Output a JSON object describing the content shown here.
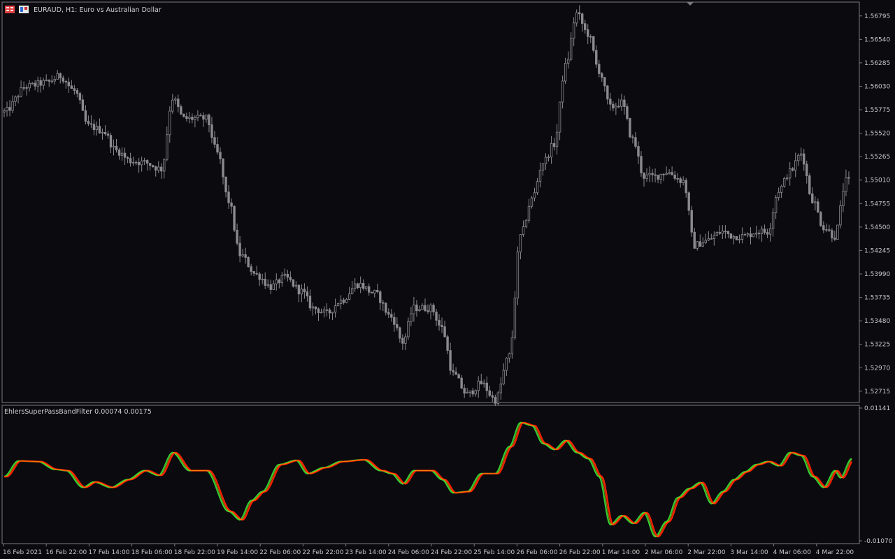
{
  "window": {
    "symbol_title": "EURAUD, H1:  Euro vs Australian Dollar"
  },
  "indicator": {
    "title": "EhlersSuperPassBandFilter 0.00074 0.00175",
    "levels": [
      "0.01141",
      "-0.01070"
    ]
  },
  "colors": {
    "background": "#0a0a0f",
    "panel_border": "#7a7a80",
    "candle": "#8a8a90",
    "filter_line": "#ff2000",
    "trigger_line": "#32cd32",
    "trigger_alt": "#ffa500"
  },
  "chart_data": [
    {
      "type": "candlestick",
      "title": "EURAUD, H1",
      "ylim": [
        1.526,
        1.5693
      ],
      "y_ticks": [
        "1.56795",
        "1.56540",
        "1.56285",
        "1.56030",
        "1.55775",
        "1.55520",
        "1.55265",
        "1.55010",
        "1.54755",
        "1.54500",
        "1.54245",
        "1.53990",
        "1.53735",
        "1.53480",
        "1.53225",
        "1.52970",
        "1.52715"
      ],
      "x_ticks": [
        "16 Feb 2021",
        "16 Feb 22:00",
        "17 Feb 14:00",
        "18 Feb 06:00",
        "18 Feb 22:00",
        "19 Feb 14:00",
        "22 Feb 06:00",
        "22 Feb 22:00",
        "23 Feb 14:00",
        "24 Feb 06:00",
        "24 Feb 22:00",
        "25 Feb 14:00",
        "26 Feb 06:00",
        "26 Feb 22:00",
        "1 Mar 14:00",
        "2 Mar 06:00",
        "2 Mar 22:00",
        "3 Mar 14:00",
        "4 Mar 06:00",
        "4 Mar 22:00"
      ],
      "close_anchors": [
        [
          0,
          1.5575
        ],
        [
          8,
          1.5603
        ],
        [
          15,
          1.5607
        ],
        [
          20,
          1.5614
        ],
        [
          25,
          1.5598
        ],
        [
          30,
          1.556
        ],
        [
          35,
          1.5555
        ],
        [
          40,
          1.5533
        ],
        [
          45,
          1.5522
        ],
        [
          50,
          1.552
        ],
        [
          56,
          1.5513
        ],
        [
          60,
          1.559
        ],
        [
          64,
          1.5568
        ],
        [
          72,
          1.5568
        ],
        [
          76,
          1.553
        ],
        [
          80,
          1.5478
        ],
        [
          84,
          1.542
        ],
        [
          90,
          1.5398
        ],
        [
          95,
          1.5385
        ],
        [
          100,
          1.5395
        ],
        [
          106,
          1.538
        ],
        [
          110,
          1.5362
        ],
        [
          115,
          1.5356
        ],
        [
          120,
          1.537
        ],
        [
          126,
          1.5388
        ],
        [
          132,
          1.5378
        ],
        [
          138,
          1.5352
        ],
        [
          142,
          1.5325
        ],
        [
          146,
          1.5362
        ],
        [
          152,
          1.5362
        ],
        [
          156,
          1.534
        ],
        [
          160,
          1.529
        ],
        [
          165,
          1.5268
        ],
        [
          170,
          1.528
        ],
        [
          175,
          1.5262
        ],
        [
          180,
          1.531
        ],
        [
          184,
          1.544
        ],
        [
          188,
          1.548
        ],
        [
          192,
          1.552
        ],
        [
          196,
          1.554
        ],
        [
          200,
          1.5625
        ],
        [
          204,
          1.5682
        ],
        [
          208,
          1.566
        ],
        [
          212,
          1.562
        ],
        [
          216,
          1.558
        ],
        [
          220,
          1.5585
        ],
        [
          224,
          1.5545
        ],
        [
          228,
          1.5505
        ],
        [
          232,
          1.5505
        ],
        [
          236,
          1.551
        ],
        [
          242,
          1.55
        ],
        [
          246,
          1.543
        ],
        [
          250,
          1.5435
        ],
        [
          256,
          1.5445
        ],
        [
          260,
          1.544
        ],
        [
          264,
          1.544
        ],
        [
          268,
          1.5445
        ],
        [
          272,
          1.5445
        ],
        [
          276,
          1.549
        ],
        [
          280,
          1.551
        ],
        [
          284,
          1.553
        ],
        [
          288,
          1.548
        ],
        [
          292,
          1.545
        ],
        [
          296,
          1.544
        ],
        [
          300,
          1.55
        ]
      ]
    },
    {
      "type": "line",
      "title": "EhlersSuperPassBandFilter",
      "ylim": [
        -0.0107,
        0.01141
      ],
      "series": [
        {
          "color": "#ff2000",
          "anchors": [
            [
              0,
              0.0
            ],
            [
              5,
              0.0026
            ],
            [
              12,
              0.0025
            ],
            [
              18,
              0.0012
            ],
            [
              22,
              0.001
            ],
            [
              28,
              -0.0018
            ],
            [
              32,
              -0.0009
            ],
            [
              38,
              -0.0018
            ],
            [
              44,
              -0.0005
            ],
            [
              50,
              0.001
            ],
            [
              55,
              0.0002
            ],
            [
              60,
              0.004
            ],
            [
              66,
              0.001
            ],
            [
              72,
              0.001
            ],
            [
              80,
              -0.0058
            ],
            [
              84,
              -0.0072
            ],
            [
              88,
              -0.004
            ],
            [
              92,
              -0.0025
            ],
            [
              98,
              0.002
            ],
            [
              104,
              0.0027
            ],
            [
              108,
              0.0005
            ],
            [
              114,
              0.0015
            ],
            [
              120,
              0.0025
            ],
            [
              128,
              0.0028
            ],
            [
              134,
              0.001
            ],
            [
              138,
              0.0005
            ],
            [
              142,
              -0.0012
            ],
            [
              146,
              0.001
            ],
            [
              152,
              0.001
            ],
            [
              156,
              -0.0005
            ],
            [
              160,
              -0.0027
            ],
            [
              165,
              -0.0025
            ],
            [
              170,
              0.0005
            ],
            [
              175,
              0.0005
            ],
            [
              180,
              0.005
            ],
            [
              184,
              0.009
            ],
            [
              188,
              0.0085
            ],
            [
              192,
              0.0055
            ],
            [
              196,
              0.0045
            ],
            [
              200,
              0.006
            ],
            [
              204,
              0.004
            ],
            [
              208,
              0.003
            ],
            [
              212,
              0.0
            ],
            [
              216,
              -0.008
            ],
            [
              220,
              -0.0065
            ],
            [
              224,
              -0.0078
            ],
            [
              228,
              -0.006
            ],
            [
              232,
              -0.01
            ],
            [
              236,
              -0.0075
            ],
            [
              240,
              -0.0035
            ],
            [
              244,
              -0.002
            ],
            [
              248,
              -0.001
            ],
            [
              252,
              -0.0045
            ],
            [
              256,
              -0.0025
            ],
            [
              260,
              -0.0005
            ],
            [
              264,
              0.0008
            ],
            [
              268,
              0.002
            ],
            [
              272,
              0.0025
            ],
            [
              276,
              0.0018
            ],
            [
              280,
              0.004
            ],
            [
              284,
              0.0035
            ],
            [
              288,
              0.0
            ],
            [
              292,
              -0.0018
            ],
            [
              296,
              0.001
            ],
            [
              298,
              -0.0002
            ],
            [
              302,
              0.003
            ]
          ]
        },
        {
          "color": "#32cd32",
          "anchors": [
            [
              0,
              0.0
            ],
            [
              5,
              0.0026
            ],
            [
              12,
              0.0025
            ],
            [
              18,
              0.0012
            ],
            [
              22,
              0.001
            ],
            [
              28,
              -0.0018
            ],
            [
              32,
              -0.0009
            ],
            [
              38,
              -0.0018
            ],
            [
              44,
              -0.0005
            ],
            [
              50,
              0.001
            ],
            [
              55,
              0.0002
            ],
            [
              60,
              0.004
            ],
            [
              66,
              0.001
            ],
            [
              72,
              0.001
            ],
            [
              80,
              -0.0058
            ],
            [
              84,
              -0.0072
            ],
            [
              88,
              -0.004
            ],
            [
              92,
              -0.0025
            ],
            [
              98,
              0.002
            ],
            [
              104,
              0.0027
            ],
            [
              108,
              0.0005
            ],
            [
              114,
              0.0015
            ],
            [
              120,
              0.0025
            ],
            [
              128,
              0.0028
            ],
            [
              134,
              0.001
            ],
            [
              138,
              0.0005
            ],
            [
              142,
              -0.0012
            ],
            [
              146,
              0.001
            ],
            [
              152,
              0.001
            ],
            [
              156,
              -0.0005
            ],
            [
              160,
              -0.0027
            ],
            [
              165,
              -0.0025
            ],
            [
              170,
              0.0005
            ],
            [
              175,
              0.0005
            ],
            [
              180,
              0.005
            ],
            [
              184,
              0.009
            ],
            [
              188,
              0.0085
            ],
            [
              192,
              0.0055
            ],
            [
              196,
              0.0045
            ],
            [
              200,
              0.006
            ],
            [
              204,
              0.004
            ],
            [
              208,
              0.003
            ],
            [
              212,
              0.0
            ],
            [
              216,
              -0.008
            ],
            [
              220,
              -0.0065
            ],
            [
              224,
              -0.0078
            ],
            [
              228,
              -0.006
            ],
            [
              232,
              -0.01
            ],
            [
              236,
              -0.0075
            ],
            [
              240,
              -0.0035
            ],
            [
              244,
              -0.002
            ],
            [
              248,
              -0.001
            ],
            [
              252,
              -0.0045
            ],
            [
              256,
              -0.0025
            ],
            [
              260,
              -0.0005
            ],
            [
              264,
              0.0008
            ],
            [
              268,
              0.002
            ],
            [
              272,
              0.0025
            ],
            [
              276,
              0.0018
            ],
            [
              280,
              0.004
            ],
            [
              284,
              0.0035
            ],
            [
              288,
              0.0
            ],
            [
              292,
              -0.0018
            ],
            [
              296,
              0.001
            ],
            [
              298,
              -0.0002
            ],
            [
              302,
              0.003
            ]
          ]
        }
      ]
    }
  ]
}
